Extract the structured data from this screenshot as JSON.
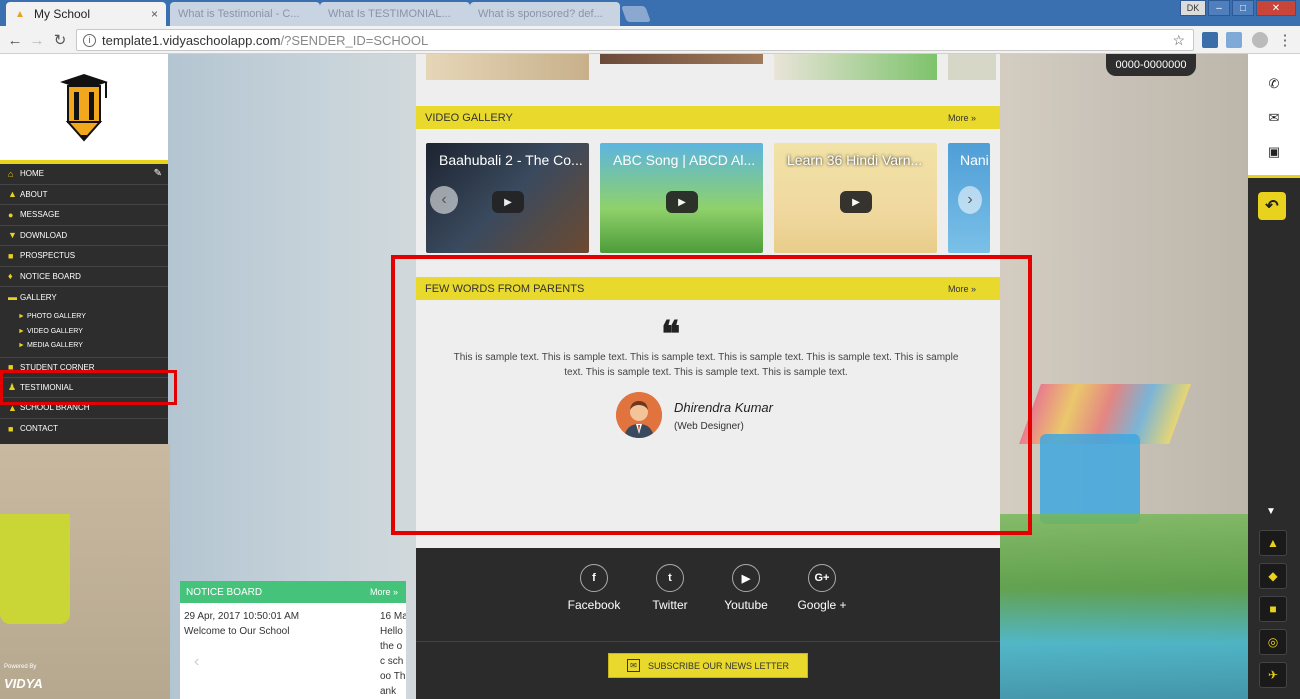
{
  "browser": {
    "active_tab_title": "My School",
    "inactive_tabs": [
      "What is Testimonial - C...",
      "What Is TESTIMONIAL...",
      "What is sponsored? def..."
    ],
    "user_badge": "DK",
    "url_host": "template1.vidyaschoolapp.com",
    "url_query": "/?SENDER_ID=SCHOOL"
  },
  "sidebar": {
    "items": [
      {
        "label": "HOME",
        "icon": "home-icon"
      },
      {
        "label": "ABOUT",
        "icon": "building-icon"
      },
      {
        "label": "MESSAGE",
        "icon": "microphone-icon"
      },
      {
        "label": "DOWNLOAD",
        "icon": "download-icon"
      },
      {
        "label": "PROSPECTUS",
        "icon": "book-icon"
      },
      {
        "label": "NOTICE BOARD",
        "icon": "bell-icon"
      },
      {
        "label": "GALLERY",
        "icon": "folder-icon"
      }
    ],
    "gallery_sub": [
      "PHOTO GALLERY",
      "VIDEO GALLERY",
      "MEDIA GALLERY"
    ],
    "items_after": [
      {
        "label": "STUDENT CORNER",
        "icon": "book-icon"
      },
      {
        "label": "TESTIMONIAL",
        "icon": "users-icon"
      },
      {
        "label": "SCHOOL BRANCH",
        "icon": "building-icon"
      },
      {
        "label": "CONTACT",
        "icon": "phone-book-icon"
      }
    ],
    "powered_by": "Powered By",
    "vidya_logo": "VIDYA"
  },
  "video_gallery": {
    "heading": "VIDEO GALLERY",
    "more": "More »",
    "videos": [
      {
        "title": "Baahubali 2 - The Co..."
      },
      {
        "title": "ABC Song | ABCD Al..."
      },
      {
        "title": "Learn 36 Hindi Varn..."
      },
      {
        "title": "Nani..."
      }
    ]
  },
  "parents": {
    "heading": "FEW WORDS FROM PARENTS",
    "more": "More »",
    "text": "This is sample text. This is sample text. This is sample text. This is sample text. This is sample text. This is sample text. This is sample text. This is sample text. This is sample text.",
    "author_name": "Dhirendra Kumar",
    "author_role": "(Web Designer)"
  },
  "footer": {
    "social": [
      {
        "label": "Facebook",
        "glyph": "f"
      },
      {
        "label": "Twitter",
        "glyph": "t"
      },
      {
        "label": "Youtube",
        "glyph": "▶"
      },
      {
        "label": "Google +",
        "glyph": "G+"
      }
    ],
    "subscribe": "SUBSCRIBE OUR NEWS LETTER"
  },
  "notice_board": {
    "heading": "NOTICE BOARD",
    "more": "More »",
    "items": [
      {
        "date": "29 Apr, 2017 10:50:01 AM",
        "text": "Welcome to Our School"
      },
      {
        "date": "16 Ma",
        "text": "Hello the oc schoo Thank"
      }
    ]
  },
  "phone": "0000-0000000",
  "colors": {
    "accent": "#e8d92c",
    "sidebar_bg": "#2d2d2d",
    "notice_green": "#46c37b",
    "highlight_red": "#e20000"
  }
}
